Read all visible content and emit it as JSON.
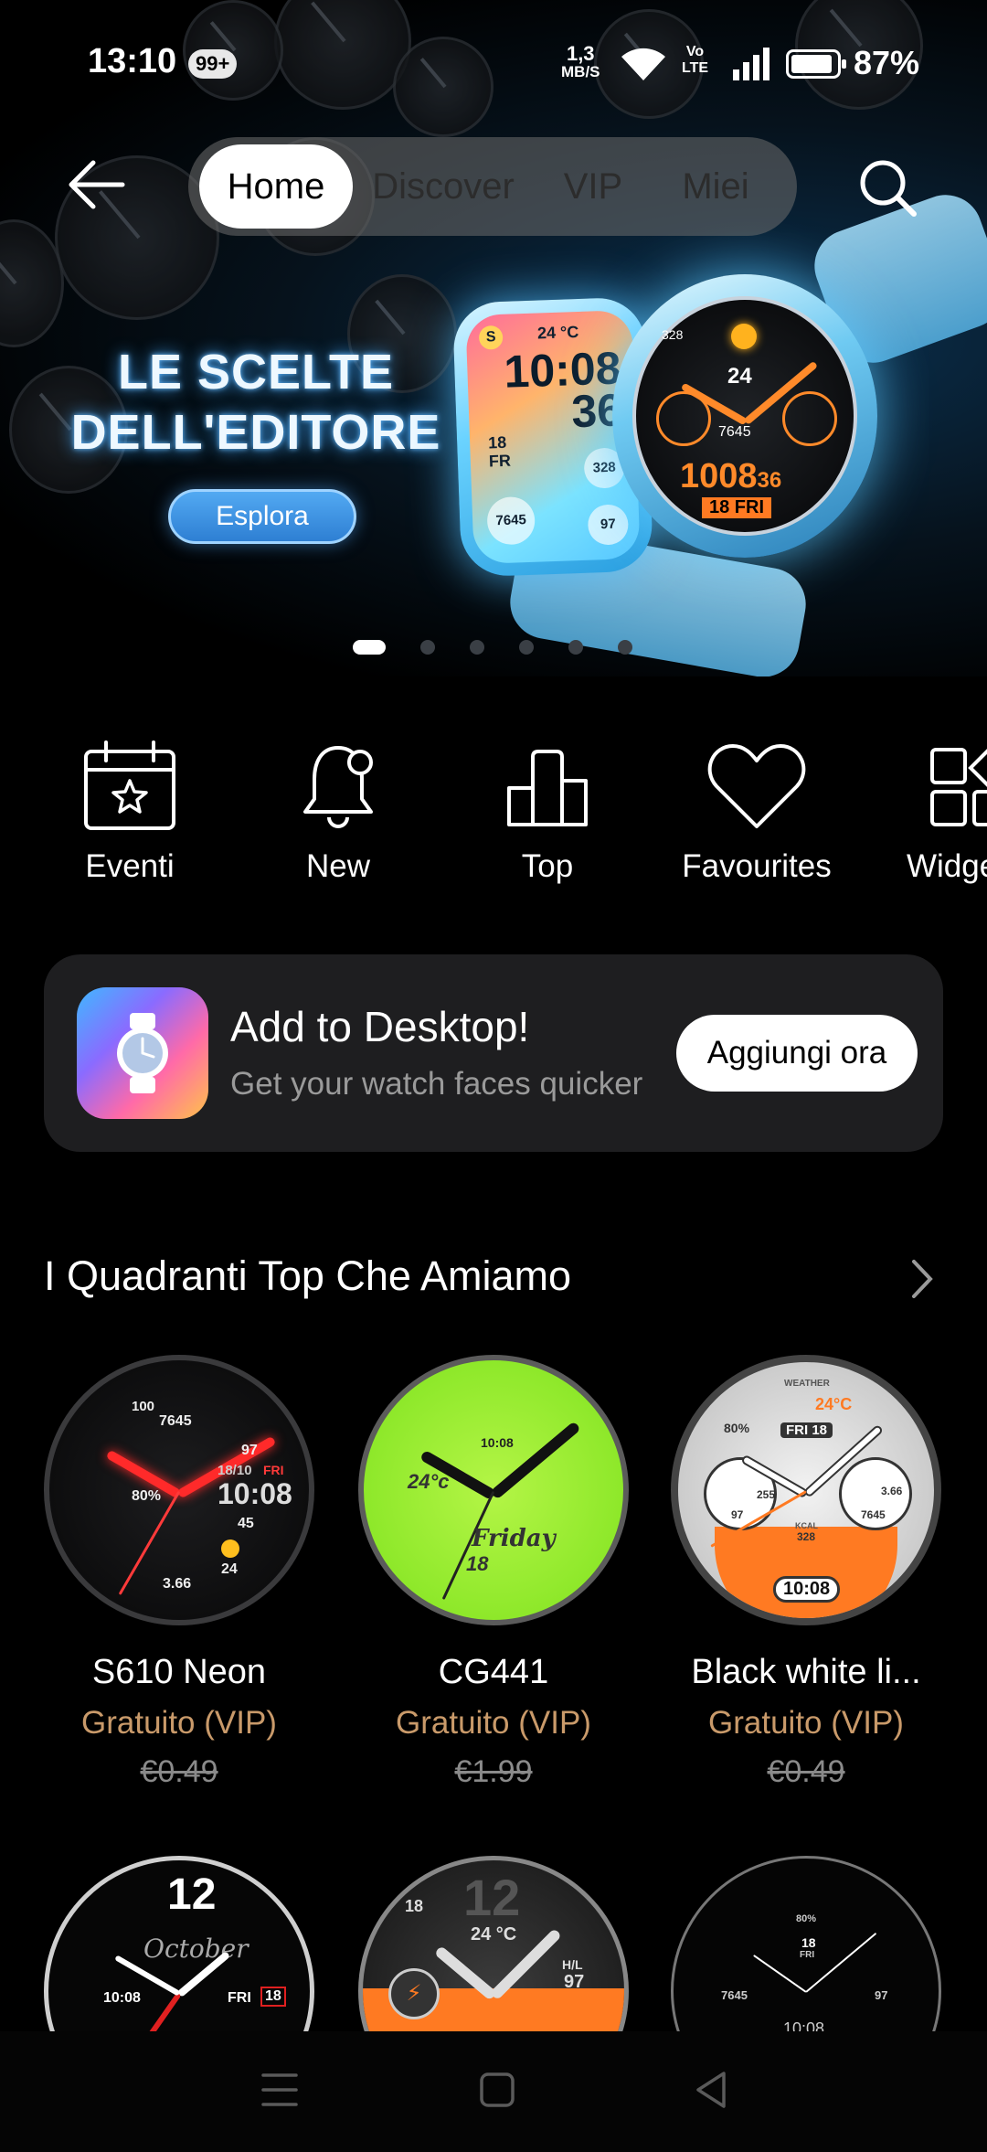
{
  "status_bar": {
    "time": "13:10",
    "badge": "99+",
    "speed_value": "1,3",
    "speed_unit": "MB/S",
    "volte_top": "Vo",
    "volte_bottom": "LTE",
    "battery": "87%"
  },
  "top_nav": {
    "tabs": [
      {
        "label": "Home",
        "active": true
      },
      {
        "label": "Discover",
        "active": false
      },
      {
        "label": "VIP",
        "active": false
      },
      {
        "label": "Miei",
        "active": false
      }
    ]
  },
  "banner": {
    "title": "LE SCELTE DELL'EDITORE",
    "button": "Esplora",
    "square_watch": {
      "time_h": "10:08",
      "time_s": "36",
      "temp": "24 °C",
      "date": "18 FR",
      "steps": "7645",
      "value1": "328",
      "value2": "97"
    },
    "round_watch": {
      "time": "1008",
      "secs": "36",
      "date": "18 FRI",
      "center": "24",
      "kcal": "328",
      "steps": "7645"
    },
    "page_count": 6,
    "active_page": 0
  },
  "categories": [
    {
      "label": "Eventi",
      "icon": "calendar-star-icon"
    },
    {
      "label": "New",
      "icon": "bell-icon"
    },
    {
      "label": "Top",
      "icon": "podium-icon"
    },
    {
      "label": "Favourites",
      "icon": "heart-icon"
    },
    {
      "label": "Widge",
      "icon": "widgets-icon"
    }
  ],
  "desktop_card": {
    "title": "Add to Desktop!",
    "subtitle": "Get your watch faces quicker",
    "button": "Aggiungi ora"
  },
  "section": {
    "title": "I Quadranti Top Che Amiamo",
    "items": [
      {
        "name": "S610 Neon",
        "price": "Gratuito (VIP)",
        "old_price": "€0.49",
        "dial_text": {
          "time": "10:08",
          "steps": "7645",
          "pct": "80%",
          "date": "18/10",
          "day": "FRI",
          "v1": "97",
          "v2": "45",
          "v3": "24",
          "v4": "3.66",
          "v5": "100"
        }
      },
      {
        "name": "CG441",
        "price": "Gratuito (VIP)",
        "old_price": "€1.99",
        "dial_text": {
          "time": "10:08",
          "day": "Friday",
          "date": "18",
          "temp": "24°c"
        }
      },
      {
        "name": "Black white li...",
        "price": "Gratuito (VIP)",
        "old_price": "€0.49",
        "dial_text": {
          "time": "10:08",
          "date": "FRI 18",
          "temp": "24°C",
          "pct": "80%",
          "v1": "255",
          "v2": "97",
          "v3": "3.66",
          "v4": "7645",
          "kcal": "KCAL",
          "kcal_v": "328",
          "weather": "WEATHER"
        }
      }
    ],
    "row2_dials": [
      {
        "month": "October",
        "time": "10:08",
        "day": "FRI",
        "date": "18",
        "hour": "12"
      },
      {
        "hour": "12",
        "temp": "24 °C",
        "v1": "97",
        "hl": "H/L",
        "date": "18"
      },
      {
        "pct": "80%",
        "date": "18",
        "day": "FRI",
        "steps": "7645",
        "v1": "97",
        "time": "10:08"
      }
    ]
  },
  "colors": {
    "accent_price": "#c99a6a",
    "card_bg": "#1e1e20",
    "tab_bar_bg": "#6e6e6e"
  }
}
